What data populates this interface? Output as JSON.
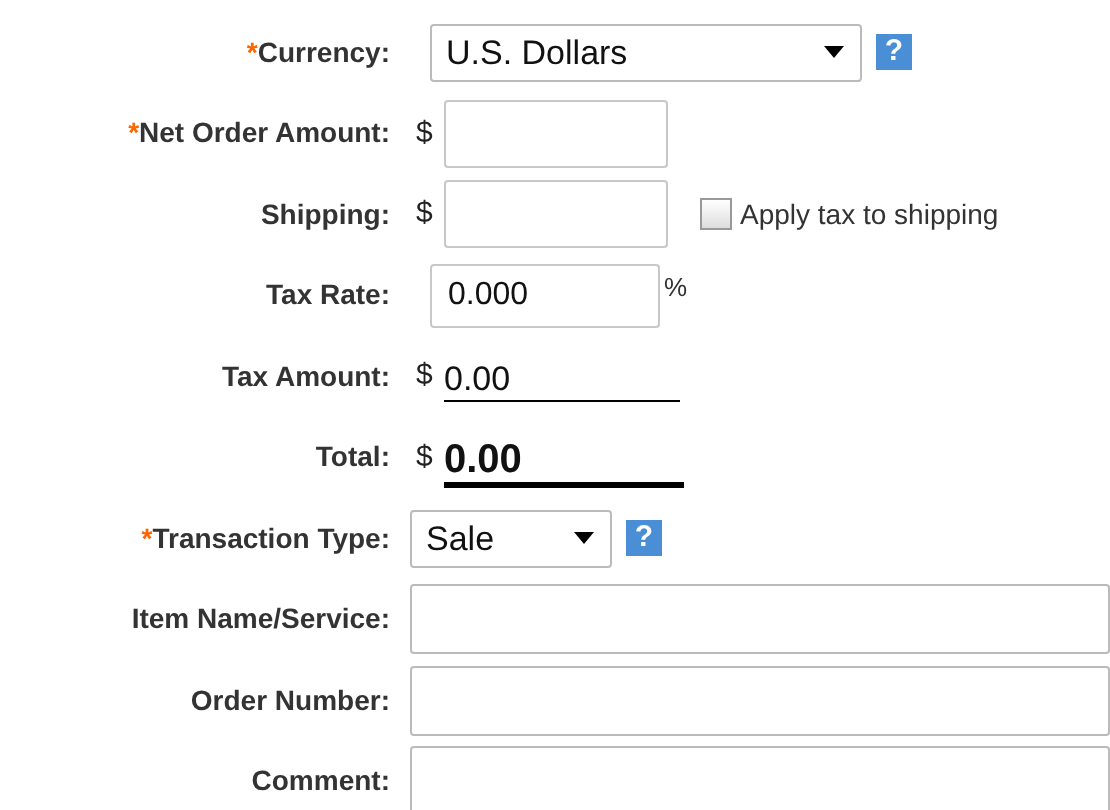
{
  "fields": [
    {
      "kind": "select",
      "label": "Currency:",
      "required_mark": "*",
      "value": "U.S. Dollars",
      "help": "?"
    },
    {
      "kind": "money",
      "label": "Net Order Amount:",
      "required_mark": "*",
      "prefix": "$"
    },
    {
      "kind": "money",
      "label": "Shipping:",
      "prefix": "$",
      "checkbox": {
        "label": "Apply tax to shipping",
        "checked": false
      }
    },
    {
      "kind": "rate",
      "label": "Tax Rate:",
      "value": "0.000",
      "suffix": "%"
    },
    {
      "kind": "display",
      "label": "Tax Amount:",
      "prefix": "$",
      "value": "0.00",
      "bold": false
    },
    {
      "kind": "display",
      "label": "Total:",
      "prefix": "$",
      "value": "0.00",
      "bold": true
    },
    {
      "kind": "small-select",
      "label": "Transaction Type:",
      "required_mark": "*",
      "value": "Sale",
      "help": "?"
    },
    {
      "kind": "text",
      "label": "Item Name/Service:"
    },
    {
      "kind": "text",
      "label": "Order Number:"
    },
    {
      "kind": "text",
      "label": "Comment:"
    }
  ]
}
